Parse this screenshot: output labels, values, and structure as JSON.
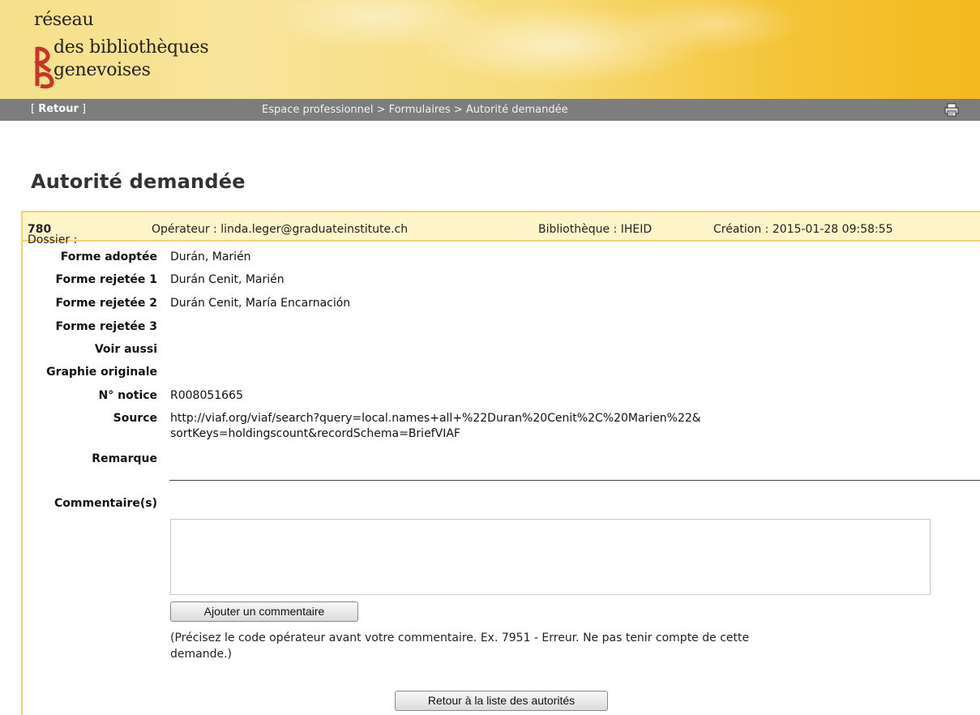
{
  "logo": {
    "line1": "réseau",
    "line2": "des bibliothèques",
    "line3": "genevoises"
  },
  "nav": {
    "retour_open": "[ ",
    "retour_label": "Retour",
    "retour_close": " ]",
    "breadcrumb": "Espace professionnel > Formulaires > Autorité demandée",
    "print_icon": "printer-icon"
  },
  "page": {
    "title": "Autorité demandée"
  },
  "dossier": {
    "dossier_label": "Dossier : ",
    "dossier_value": "780",
    "operateur": "Opérateur : linda.leger@graduateinstitute.ch",
    "bibliotheque": "Bibliothèque : IHEID",
    "creation": "Création : 2015-01-28 09:58:55"
  },
  "fields": [
    {
      "label": "Forme adoptée",
      "value": "Durán, Marién"
    },
    {
      "label": "Forme rejetée 1",
      "value": "Durán Cenit, Marién"
    },
    {
      "label": "Forme rejetée 2",
      "value": "Durán Cenit, María Encarnación"
    },
    {
      "label": "Forme rejetée 3",
      "value": ""
    },
    {
      "label": "Voir aussi",
      "value": ""
    },
    {
      "label": "Graphie originale",
      "value": ""
    },
    {
      "label": "N° notice",
      "value": "R008051665"
    },
    {
      "label": "Source",
      "value": "http://viaf.org/viaf/search?query=local.names+all+%22Duran%20Cenit%2C%20Marien%22&",
      "value2": "sortKeys=holdingscount&recordSchema=BriefVIAF"
    },
    {
      "label": "Remarque",
      "value": ""
    }
  ],
  "comments": {
    "label": "Commentaire(s)",
    "textarea_value": "",
    "add_button": "Ajouter un commentaire",
    "hint_line1": "(Précisez le code opérateur avant votre commentaire. Ex. 7951 - Erreur. Ne pas tenir compte de cette",
    "hint_line2": "demande.)"
  },
  "footer": {
    "back_button": "Retour à la liste des autorités"
  },
  "colors": {
    "nav_bg": "#7d7d7d",
    "dossier_bg": "#fdf5c9",
    "border_accent": "#f2d46b",
    "logo_red": "#c8342b"
  }
}
